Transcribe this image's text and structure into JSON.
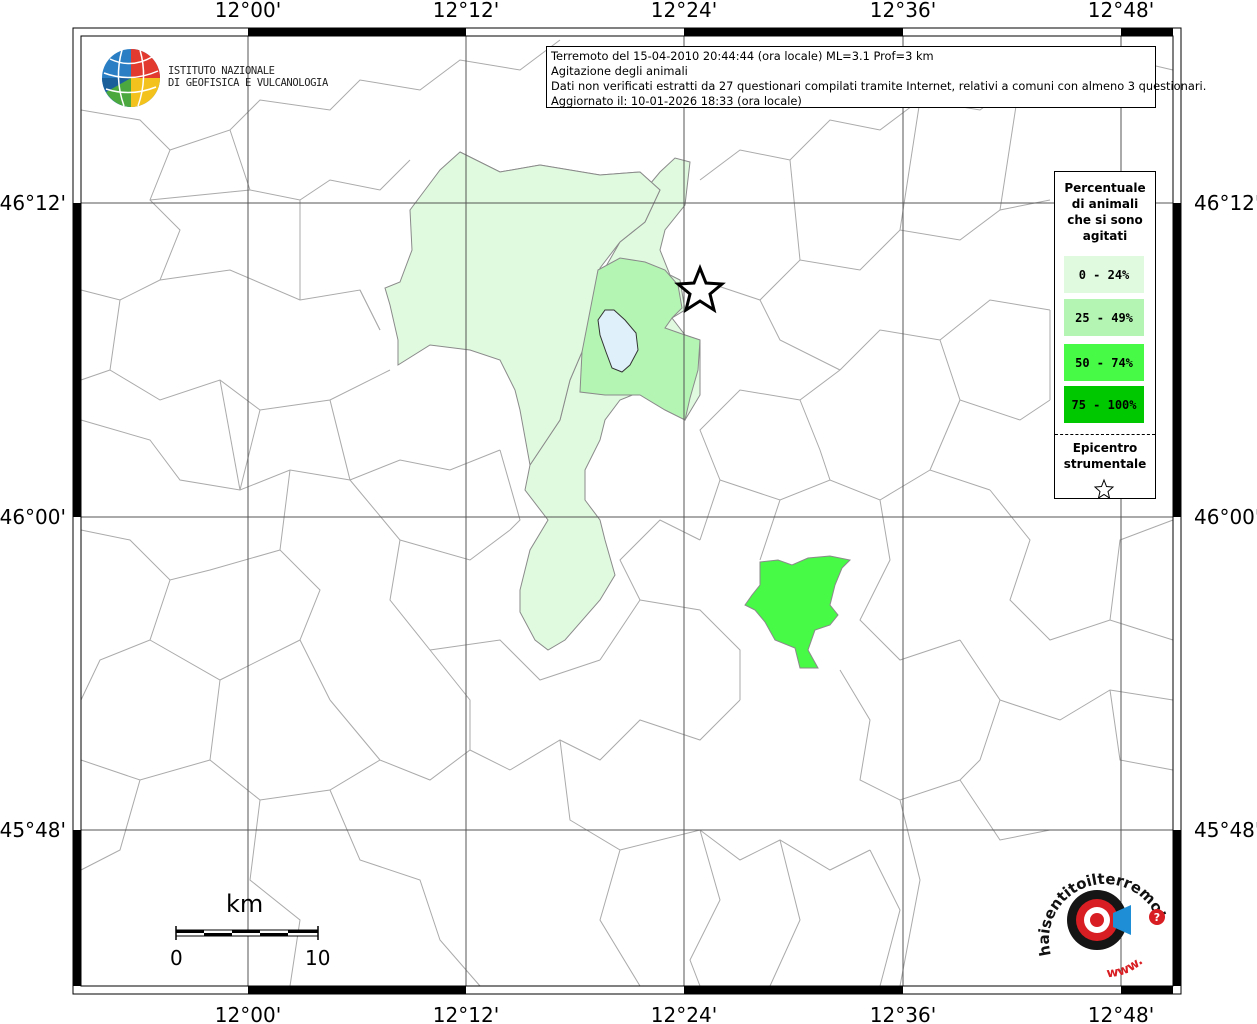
{
  "map": {
    "frame_labels": {
      "lon": [
        "12°00'",
        "12°12'",
        "12°24'",
        "12°36'",
        "12°48'"
      ],
      "lat": [
        "46°12'",
        "46°00'",
        "45°48'"
      ]
    },
    "colors": {
      "class_0_24": "#e0fae0",
      "class_25_49": "#b4f5b4",
      "class_50_74": "#46fa46",
      "class_75_100": "#00c800",
      "lake": "#e0f0fa",
      "boundary": "#aaaaaa",
      "grid": "#555555"
    }
  },
  "logo_ingv": {
    "line1": "ISTITUTO NAZIONALE",
    "line2": "DI GEOFISICA E VULCANOLOGIA"
  },
  "info": {
    "line1": "Terremoto del 15-04-2010 20:44:44 (ora locale) ML=3.1 Prof=3 km",
    "line2": "Agitazione degli animali",
    "line3": "Dati non verificati estratti da 27 questionari compilati tramite Internet, relativi a comuni con almeno 3 questionari.",
    "line4": "Aggiornato il: 10-01-2026 18:33 (ora locale)"
  },
  "legend": {
    "title_line1": "Percentuale",
    "title_line2": "di animali",
    "title_line3": "che si sono",
    "title_line4": "agitati",
    "items": [
      {
        "label": "0 - 24%",
        "color": "#e0fae0"
      },
      {
        "label": "25 - 49%",
        "color": "#b4f5b4"
      },
      {
        "label": "50 - 74%",
        "color": "#46fa46"
      },
      {
        "label": "75 - 100%",
        "color": "#00c800"
      }
    ],
    "epicentre_line1": "Epicentro",
    "epicentre_line2": "strumentale",
    "epicentre_icon": "star-icon"
  },
  "scale": {
    "unit": "km",
    "start": "0",
    "end": "10"
  },
  "logo_hsit": {
    "text_top": "haisentitoilterremoto.it",
    "text_bottom": "www."
  }
}
